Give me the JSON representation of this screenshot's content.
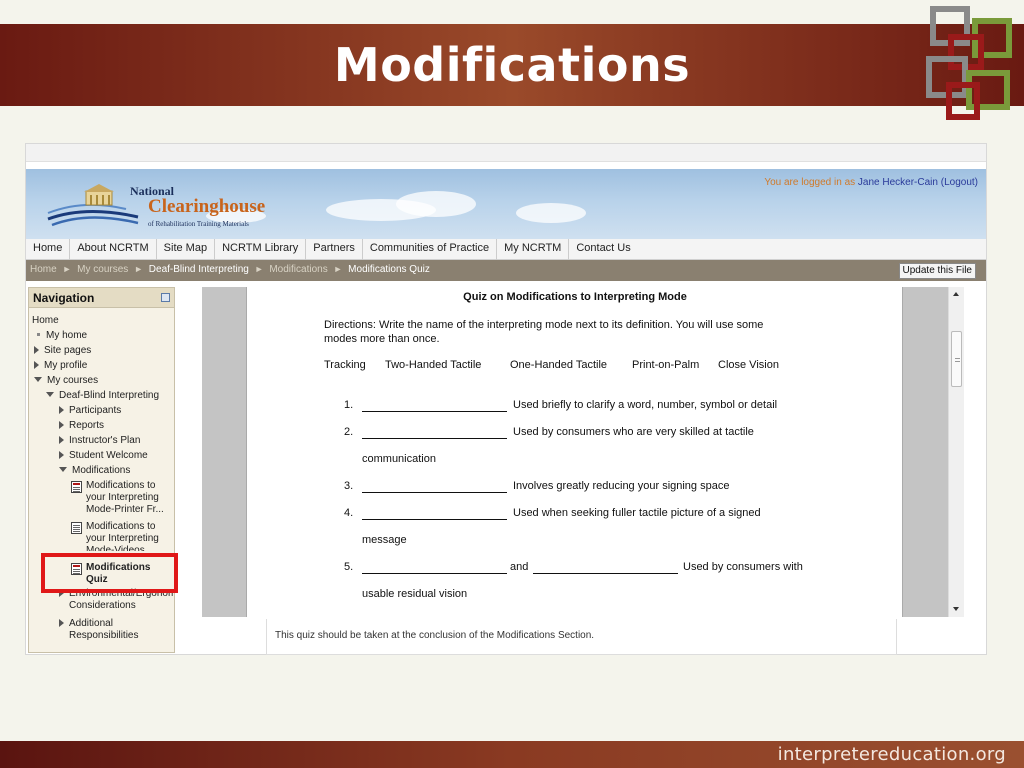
{
  "slide": {
    "title": "Modifications",
    "footer": "interpretereducation.org",
    "accent_color": "#8a3a22"
  },
  "site": {
    "brand_national": "National",
    "brand_clearinghouse": "Clearinghouse",
    "brand_subtitle": "of Rehabilitation Training Materials",
    "login_prefix": "You are logged in as",
    "login_user": "Jane Hecker-Cain",
    "login_logout": "(Logout)",
    "menu": [
      "Home",
      "About NCRTM",
      "Site Map",
      "NCRTM Library",
      "Partners",
      "Communities of Practice",
      "My NCRTM",
      "Contact Us"
    ],
    "breadcrumbs": [
      "Home",
      "My courses",
      "Deaf-Blind Interpreting",
      "Modifications",
      "Modifications Quiz"
    ],
    "update_button": "Update this File"
  },
  "navigation": {
    "title": "Navigation",
    "items": [
      {
        "label": "Home"
      },
      {
        "label": "My home"
      },
      {
        "label": "Site pages"
      },
      {
        "label": "My profile"
      },
      {
        "label": "My courses"
      },
      {
        "label": "Deaf-Blind Interpreting"
      },
      {
        "label": "Participants"
      },
      {
        "label": "Reports"
      },
      {
        "label": "Instructor's Plan"
      },
      {
        "label": "Student Welcome"
      },
      {
        "label": "Modifications"
      },
      {
        "label": "Modifications to your Interpreting Mode-Printer Fr..."
      },
      {
        "label": "Modifications to your Interpreting Mode-Videos"
      },
      {
        "label": "Modifications Quiz"
      },
      {
        "label": "Environmental/Ergonom Considerations"
      },
      {
        "label": "Additional Responsibilities"
      }
    ]
  },
  "quiz": {
    "title": "Quiz on Modifications to Interpreting Mode",
    "directions_line1": "Directions: Write the name of the interpreting mode next to its definition.  You will use some",
    "directions_line2": "modes more than once.",
    "modes": [
      "Tracking",
      "Two-Handed Tactile",
      "One-Handed Tactile",
      "Print-on-Palm",
      "Close Vision"
    ],
    "questions": [
      {
        "num": "1.",
        "text": "Used briefly to clarify a word, number, symbol or detail",
        "cont": ""
      },
      {
        "num": "2.",
        "text": "Used by consumers who are very skilled at tactile",
        "cont": "communication"
      },
      {
        "num": "3.",
        "text": "Involves greatly reducing your signing space",
        "cont": ""
      },
      {
        "num": "4.",
        "text": "Used when seeking fuller tactile picture of a signed",
        "cont": "message"
      },
      {
        "num": "5.",
        "and": "and",
        "text": "Used by consumers with",
        "cont": "usable residual vision"
      }
    ]
  },
  "note": "This quiz should be taken at the conclusion of the Modifications Section."
}
